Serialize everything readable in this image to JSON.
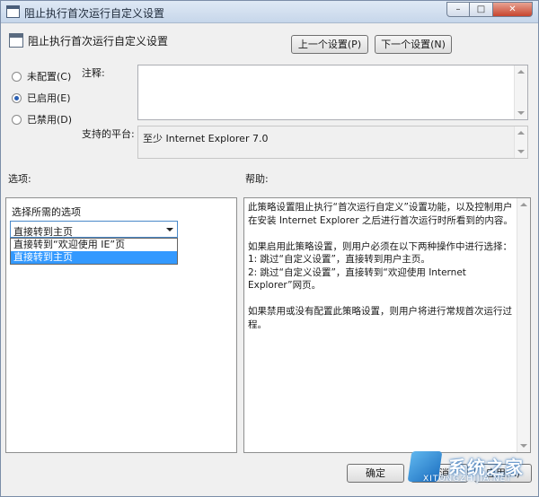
{
  "window": {
    "title": "阻止执行首次运行自定义设置"
  },
  "header": {
    "title": "阻止执行首次运行自定义设置",
    "prev_button": "上一个设置(P)",
    "next_button": "下一个设置(N)"
  },
  "options": [
    {
      "label": "未配置(C)",
      "checked": false
    },
    {
      "label": "已启用(E)",
      "checked": true
    },
    {
      "label": "已禁用(D)",
      "checked": false
    }
  ],
  "comment": {
    "label": "注释:",
    "value": ""
  },
  "supported": {
    "label": "支持的平台:",
    "value": "至少 Internet Explorer 7.0"
  },
  "options_panel": {
    "label": "选项:",
    "choose_label": "选择所需的选项",
    "selected": "直接转到主页",
    "dropdown_items": [
      {
        "label": "直接转到“欢迎使用 IE”页",
        "selected": false
      },
      {
        "label": "直接转到主页",
        "selected": true
      }
    ]
  },
  "help_panel": {
    "label": "帮助:",
    "paragraphs": [
      "此策略设置阻止执行“首次运行自定义”设置功能，以及控制用户在安装 Internet Explorer 之后进行首次运行时所看到的内容。",
      "如果启用此策略设置，则用户必须在以下两种操作中进行选择：\n1: 跳过“自定义设置”，直接转到用户主页。\n2: 跳过“自定义设置”，直接转到“欢迎使用 Internet Explorer”网页。",
      "如果禁用或没有配置此策略设置，则用户将进行常规首次运行过程。"
    ]
  },
  "footer": {
    "ok_button": "确定",
    "cancel_button": "取消",
    "apply_button": "应用(A)"
  },
  "watermark": {
    "text": "系统之家",
    "sub": "XITONGZHIJIA.NET"
  }
}
